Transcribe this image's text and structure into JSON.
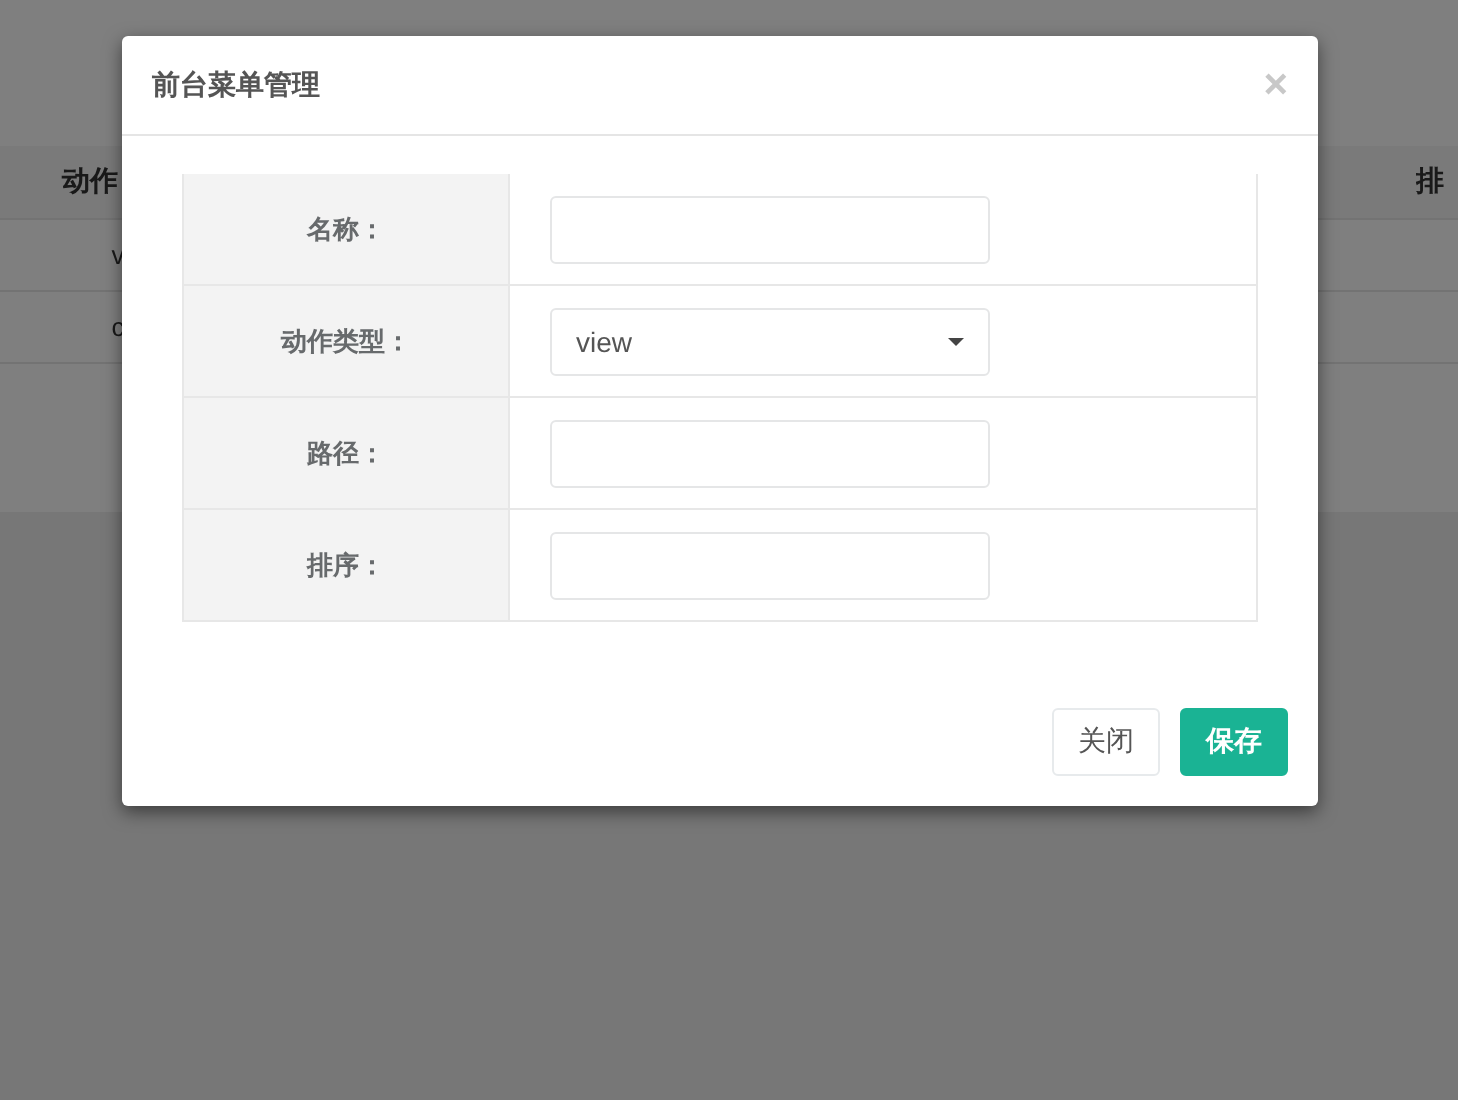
{
  "background_table": {
    "columns": [
      "动作",
      "排"
    ],
    "rows": [
      [
        "v"
      ],
      [
        "c"
      ]
    ]
  },
  "modal": {
    "title": "前台菜单管理",
    "close": "×",
    "fields": [
      {
        "label": "名称：",
        "kind": "text"
      },
      {
        "label": "动作类型：",
        "kind": "select",
        "value": "view"
      },
      {
        "label": "路径：",
        "kind": "text"
      },
      {
        "label": "排序：",
        "kind": "text"
      }
    ],
    "buttons": [
      {
        "label": "关闭",
        "kind": "default"
      },
      {
        "label": "保存",
        "kind": "primary"
      }
    ]
  }
}
